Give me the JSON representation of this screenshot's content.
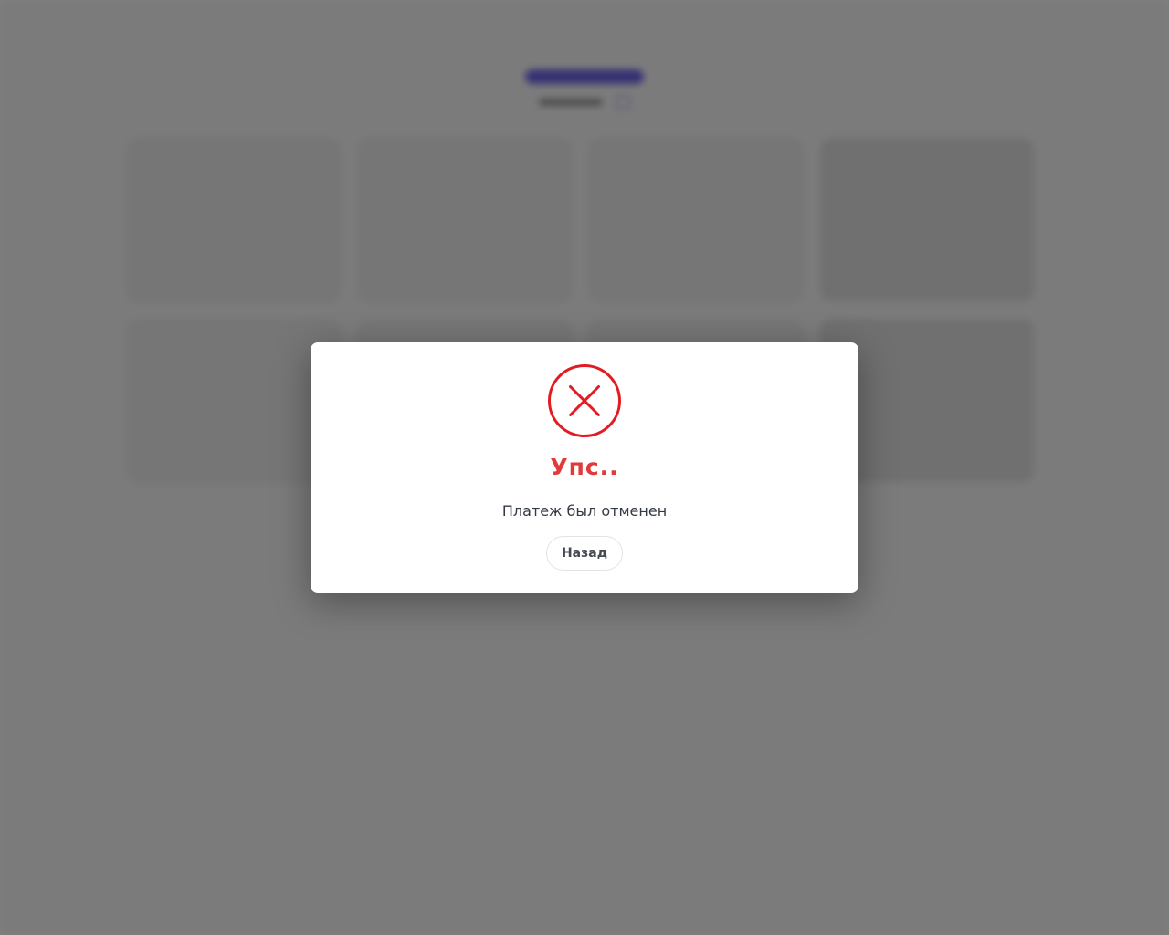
{
  "modal": {
    "icon": "close-circle-icon",
    "title": "Упс..",
    "message": "Платеж был отменен",
    "back_label": "Назад"
  },
  "colors": {
    "error": "#e31b23",
    "title": "#e03a3a",
    "brand": "#6b63e8",
    "overlay": "rgba(0,0,0,0.5)"
  }
}
